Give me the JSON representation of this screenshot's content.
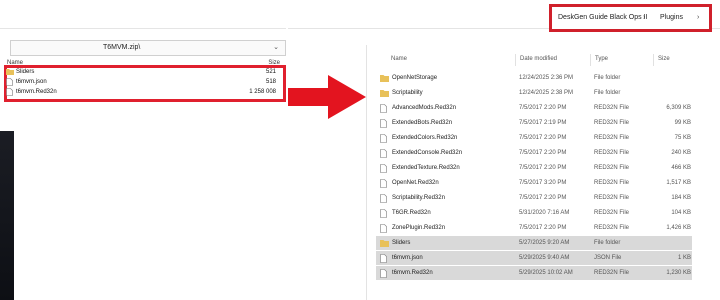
{
  "left_window": {
    "path": "T6MVM.zip\\",
    "columns": {
      "name": "Name",
      "size": "Size"
    },
    "items": [
      {
        "name": "Sliders",
        "size": "521",
        "icon": "folder-icon"
      },
      {
        "name": "t6mvm.json",
        "size": "518",
        "icon": "file-icon"
      },
      {
        "name": "t6mvm.Red32n",
        "size": "1 258 008",
        "icon": "file-icon"
      }
    ]
  },
  "breadcrumb": {
    "segments": [
      "DeskGen Guide Black Ops II",
      "Plugins"
    ],
    "separator": "›"
  },
  "right_window": {
    "columns": {
      "name": "Name",
      "date": "Date modified",
      "type": "Type",
      "size": "Size"
    },
    "rows": [
      {
        "name": "OpenNetStorage",
        "date": "12/24/2025 2:36 PM",
        "type": "File folder",
        "size": "",
        "icon": "folder-icon",
        "selected": false
      },
      {
        "name": "Scriptability",
        "date": "12/24/2025 2:38 PM",
        "type": "File folder",
        "size": "",
        "icon": "folder-icon",
        "selected": false
      },
      {
        "name": "AdvancedMods.Red32n",
        "date": "7/5/2017 2:20 PM",
        "type": "RED32N File",
        "size": "6,309 KB",
        "icon": "file-icon",
        "selected": false
      },
      {
        "name": "ExtendedBots.Red32n",
        "date": "7/5/2017 2:19 PM",
        "type": "RED32N File",
        "size": "99 KB",
        "icon": "file-icon",
        "selected": false
      },
      {
        "name": "ExtendedColors.Red32n",
        "date": "7/5/2017 2:20 PM",
        "type": "RED32N File",
        "size": "75 KB",
        "icon": "file-icon",
        "selected": false
      },
      {
        "name": "ExtendedConsole.Red32n",
        "date": "7/5/2017 2:20 PM",
        "type": "RED32N File",
        "size": "240 KB",
        "icon": "file-icon",
        "selected": false
      },
      {
        "name": "ExtendedTexture.Red32n",
        "date": "7/5/2017 2:20 PM",
        "type": "RED32N File",
        "size": "466 KB",
        "icon": "file-icon",
        "selected": false
      },
      {
        "name": "OpenNet.Red32n",
        "date": "7/5/2017 3:20 PM",
        "type": "RED32N File",
        "size": "1,517 KB",
        "icon": "file-icon",
        "selected": false
      },
      {
        "name": "Scriptability.Red32n",
        "date": "7/5/2017 2:20 PM",
        "type": "RED32N File",
        "size": "184 KB",
        "icon": "file-icon",
        "selected": false
      },
      {
        "name": "T6GR.Red32n",
        "date": "5/31/2020 7:16 AM",
        "type": "RED32N File",
        "size": "104 KB",
        "icon": "file-icon",
        "selected": false
      },
      {
        "name": "ZonePlugin.Red32n",
        "date": "7/5/2017 2:20 PM",
        "type": "RED32N File",
        "size": "1,426 KB",
        "icon": "file-icon",
        "selected": false
      },
      {
        "name": "Sliders",
        "date": "5/27/2025 9:20 AM",
        "type": "File folder",
        "size": "",
        "icon": "folder-icon",
        "selected": true
      },
      {
        "name": "t6mvm.json",
        "date": "5/29/2025 9:40 AM",
        "type": "JSON File",
        "size": "1 KB",
        "icon": "file-icon",
        "selected": true
      },
      {
        "name": "t6mvm.Red32n",
        "date": "5/29/2025 10:02 AM",
        "type": "RED32N File",
        "size": "1,230 KB",
        "icon": "file-icon",
        "selected": true
      }
    ]
  },
  "colors": {
    "highlight_border": "#e0202e",
    "arrow": "#e3141f",
    "folder": "#e8c15a",
    "selected_row": "#d9d9d9"
  }
}
